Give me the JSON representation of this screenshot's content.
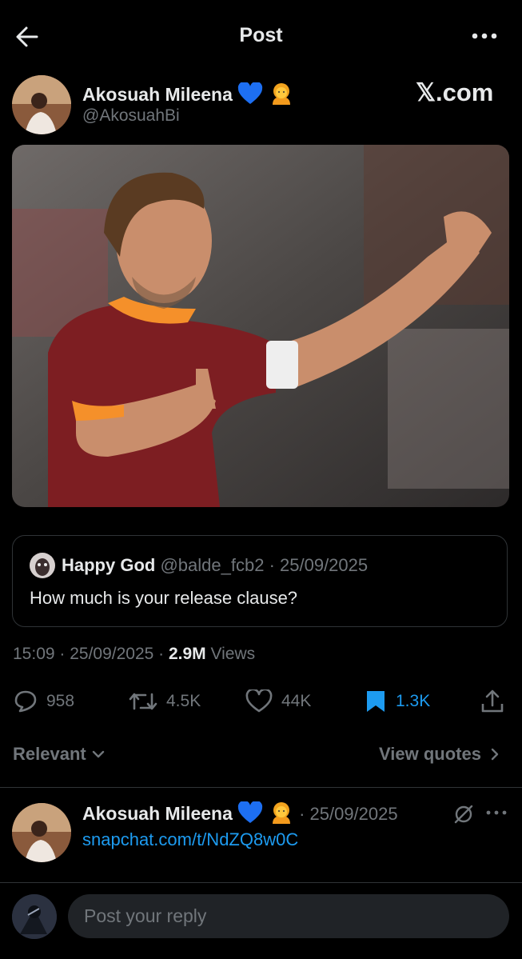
{
  "header": {
    "title": "Post"
  },
  "post": {
    "author_name": "Akosuah Mileena",
    "author_handle": "@AkosuahBi",
    "watermark": "𝕏.com",
    "quote": {
      "name": "Happy God",
      "handle": "@balde_fcb2",
      "date": "· 25/09/2025",
      "text": "How much is your release clause?"
    },
    "time": "15:09 · 25/09/2025 · ",
    "views_count": "2.9M",
    "views_label": " Views",
    "stats": {
      "replies": "958",
      "reposts": "4.5K",
      "likes": "44K",
      "bookmarks": "1.3K"
    }
  },
  "filter": {
    "relevant_label": "Relevant",
    "view_quotes_label": "View quotes"
  },
  "reply": {
    "author_name": "Akosuah Mileena",
    "date": "· 25/09/2025",
    "link": "snapchat.com/t/NdZQ8w0C"
  },
  "composer": {
    "placeholder": "Post your reply"
  },
  "colors": {
    "accent": "#1d9bf0",
    "background": "#000000",
    "muted": "#71767b",
    "heart_emoji": "#1d6ff2"
  },
  "icons": [
    "back-arrow-icon",
    "more-icon",
    "blue-heart-icon",
    "person-emoji-icon",
    "reply-icon",
    "repost-icon",
    "like-icon",
    "bookmark-icon",
    "share-icon",
    "chevron-down-icon",
    "chevron-right-icon",
    "grok-icon"
  ]
}
